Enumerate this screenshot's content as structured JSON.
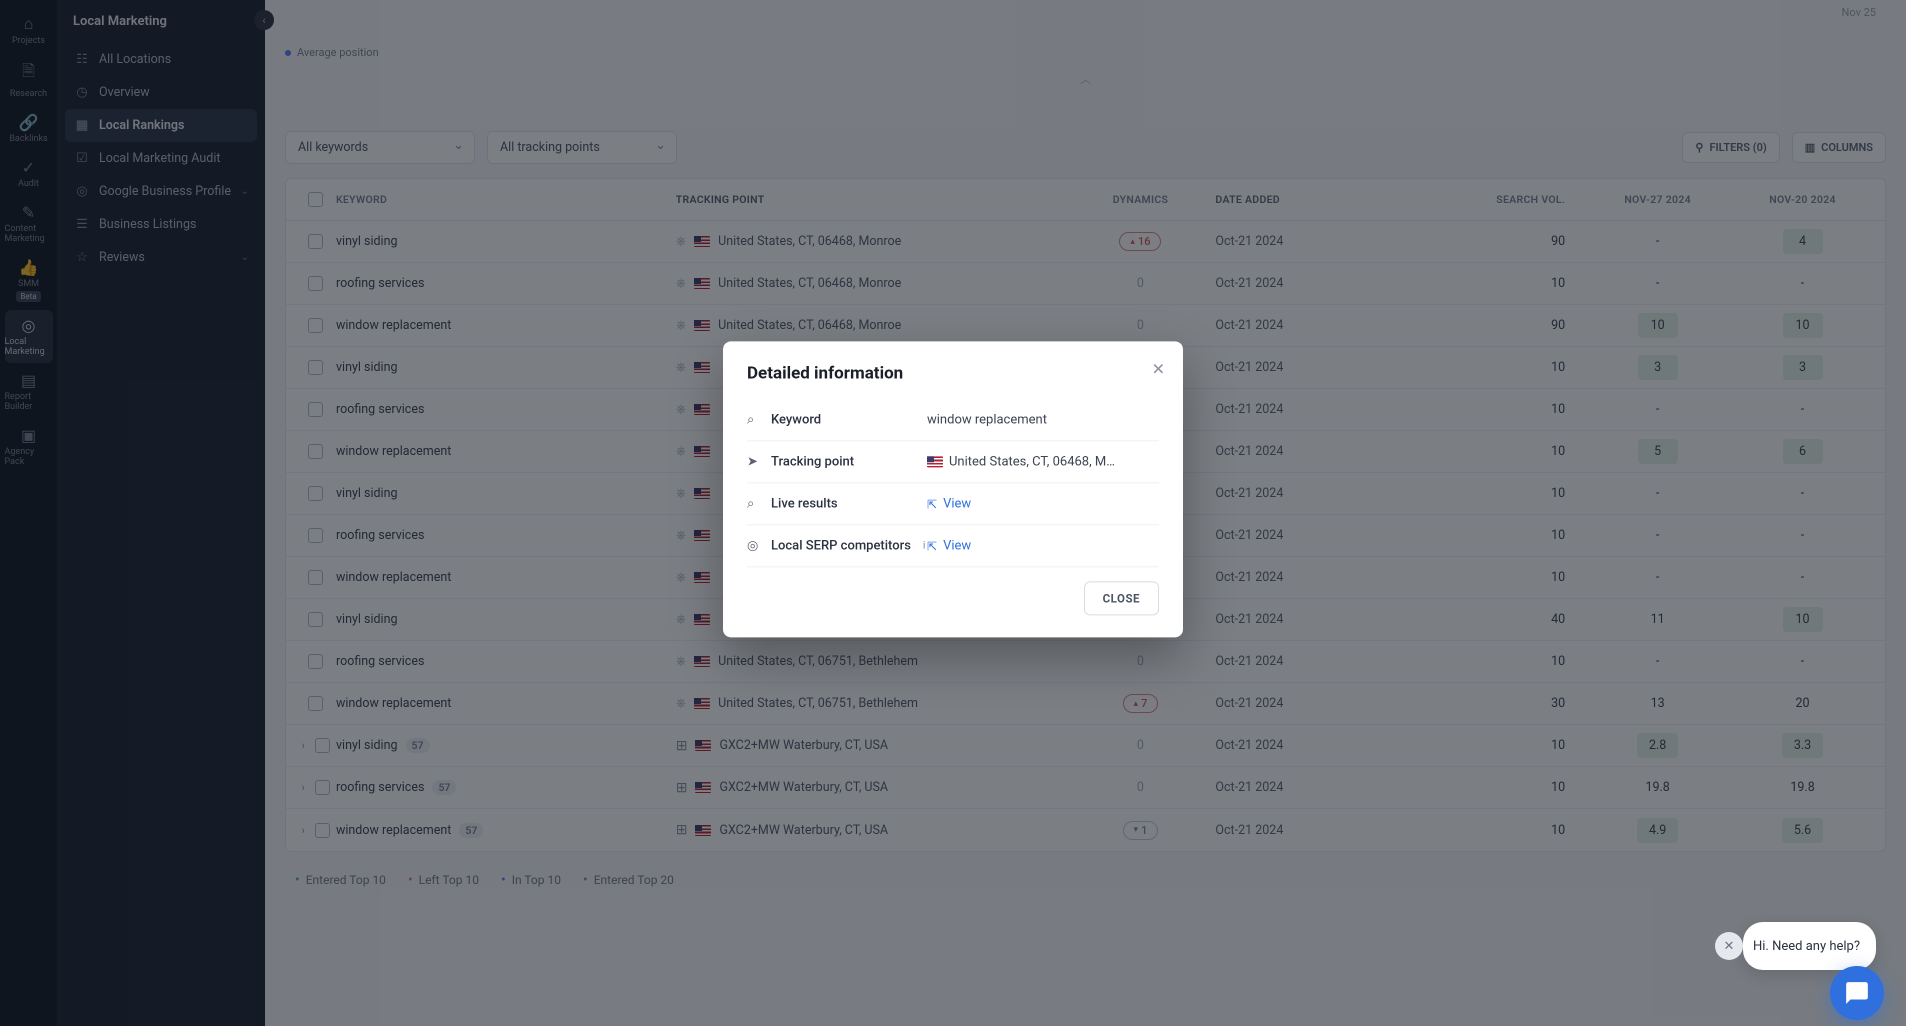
{
  "primaryNav": {
    "items": [
      {
        "label": "Projects",
        "icon": "home"
      },
      {
        "label": "Research",
        "icon": "doc"
      },
      {
        "label": "Backlinks",
        "icon": "link"
      },
      {
        "label": "Audit",
        "icon": "check"
      },
      {
        "label": "Content Marketing",
        "icon": "edit"
      },
      {
        "label": "SMM",
        "icon": "thumb",
        "badge": "Beta"
      },
      {
        "label": "Local Marketing",
        "icon": "pin",
        "active": true
      },
      {
        "label": "Report Builder",
        "icon": "report"
      },
      {
        "label": "Agency Pack",
        "icon": "agency"
      }
    ]
  },
  "secondaryNav": {
    "title": "Local Marketing",
    "items": [
      {
        "label": "All Locations",
        "icon": "grid",
        "hasSub": false
      },
      {
        "label": "Overview",
        "icon": "gauge",
        "hasSub": false
      },
      {
        "label": "Local Rankings",
        "icon": "bars",
        "active": true
      },
      {
        "label": "Local Marketing Audit",
        "icon": "audit"
      },
      {
        "label": "Google Business Profile",
        "icon": "gbp",
        "hasSub": true
      },
      {
        "label": "Business Listings",
        "icon": "list"
      },
      {
        "label": "Reviews",
        "icon": "star",
        "hasSub": true
      }
    ]
  },
  "chart": {
    "legend": "Average position",
    "dateLbl": "Nov 25"
  },
  "toolbar": {
    "filter1": "All keywords",
    "filter2": "All tracking points",
    "filtersBtn": "FILTERS (0)",
    "columnsBtn": "COLUMNS"
  },
  "table": {
    "headers": {
      "kw": "KEYWORD",
      "tp": "TRACKING POINT",
      "dyn": "DYNAMICS",
      "date": "DATE ADDED",
      "vol": "SEARCH VOL.",
      "d1": "NOV-27 2024",
      "d2": "NOV-20 2024"
    },
    "rows": [
      {
        "kw": "vinyl siding",
        "tpType": "pin",
        "tp": "United States, CT, 06468, Monroe",
        "dyn": {
          "type": "up",
          "val": "16"
        },
        "date": "Oct-21 2024",
        "vol": "90",
        "d1": "-",
        "d2": "4",
        "d2hl": true
      },
      {
        "kw": "roofing services",
        "tpType": "pin",
        "tp": "United States, CT, 06468, Monroe",
        "dyn": {
          "type": "zero"
        },
        "date": "Oct-21 2024",
        "vol": "10",
        "d1": "-",
        "d2": "-"
      },
      {
        "kw": "window replacement",
        "tpType": "pin",
        "tp": "United States, CT, 06468, Monroe",
        "dyn": {
          "type": "zero"
        },
        "date": "Oct-21 2024",
        "vol": "90",
        "d1": "10",
        "d1hl": true,
        "d2": "10",
        "d2hl": true
      },
      {
        "kw": "vinyl siding",
        "tpType": "pin",
        "tp": "",
        "dyn": {
          "type": "none"
        },
        "date": "Oct-21 2024",
        "vol": "10",
        "d1": "3",
        "d1hl": true,
        "d2": "3",
        "d2hl": true
      },
      {
        "kw": "roofing services",
        "tpType": "pin",
        "tp": "",
        "dyn": {
          "type": "none"
        },
        "date": "Oct-21 2024",
        "vol": "10",
        "d1": "-",
        "d2": "-"
      },
      {
        "kw": "window replacement",
        "tpType": "pin",
        "tp": "",
        "dyn": {
          "type": "none"
        },
        "date": "Oct-21 2024",
        "vol": "10",
        "d1": "5",
        "d1hl": true,
        "d2": "6",
        "d2hl": true
      },
      {
        "kw": "vinyl siding",
        "tpType": "pin",
        "tp": "",
        "dyn": {
          "type": "none"
        },
        "date": "Oct-21 2024",
        "vol": "10",
        "d1": "-",
        "d2": "-"
      },
      {
        "kw": "roofing services",
        "tpType": "pin",
        "tp": "",
        "dyn": {
          "type": "none"
        },
        "date": "Oct-21 2024",
        "vol": "10",
        "d1": "-",
        "d2": "-"
      },
      {
        "kw": "window replacement",
        "tpType": "pin",
        "tp": "",
        "dyn": {
          "type": "none"
        },
        "date": "Oct-21 2024",
        "vol": "10",
        "d1": "-",
        "d2": "-"
      },
      {
        "kw": "vinyl siding",
        "tpType": "pin",
        "tp": "",
        "dyn": {
          "type": "none"
        },
        "date": "Oct-21 2024",
        "vol": "40",
        "d1": "11",
        "d2": "10",
        "d2hl": true
      },
      {
        "kw": "roofing services",
        "tpType": "pin",
        "tp": "United States, CT, 06751, Bethlehem",
        "dyn": {
          "type": "zero"
        },
        "date": "Oct-21 2024",
        "vol": "10",
        "d1": "-",
        "d2": "-"
      },
      {
        "kw": "window replacement",
        "tpType": "pin",
        "tp": "United States, CT, 06751, Bethlehem",
        "dyn": {
          "type": "up",
          "val": "7"
        },
        "date": "Oct-21 2024",
        "vol": "30",
        "d1": "13",
        "d2": "20"
      },
      {
        "expand": true,
        "kw": "vinyl siding",
        "badge": "57",
        "tpType": "grid",
        "tp": "GXC2+MW Waterbury, CT, USA",
        "dyn": {
          "type": "zero"
        },
        "date": "Oct-21 2024",
        "vol": "10",
        "d1": "2.8",
        "d1hl": true,
        "d2": "3.3",
        "d2hl": true
      },
      {
        "expand": true,
        "kw": "roofing services",
        "badge": "57",
        "tpType": "grid",
        "tp": "GXC2+MW Waterbury, CT, USA",
        "dyn": {
          "type": "zero"
        },
        "date": "Oct-21 2024",
        "vol": "10",
        "d1": "19.8",
        "d2": "19.8"
      },
      {
        "expand": true,
        "kw": "window replacement",
        "badge": "57",
        "tpType": "grid",
        "tp": "GXC2+MW Waterbury, CT, USA",
        "dyn": {
          "type": "down",
          "val": "1"
        },
        "date": "Oct-21 2024",
        "vol": "10",
        "d1": "4.9",
        "d1hl": true,
        "d2": "5.6",
        "d2hl": true
      }
    ]
  },
  "legendFooter": {
    "l1": "Entered Top 10",
    "l2": "Left Top 10",
    "l3": "In Top 10",
    "l4": "Entered Top 20"
  },
  "modal": {
    "title": "Detailed information",
    "rows": {
      "keyword": {
        "label": "Keyword",
        "value": "window replacement"
      },
      "tracking": {
        "label": "Tracking point",
        "value": "United States, CT, 06468, M…"
      },
      "live": {
        "label": "Live results",
        "link": "View"
      },
      "serp": {
        "label": "Local SERP competitors",
        "sup": "i",
        "link": "View"
      }
    },
    "closeBtn": "CLOSE"
  },
  "help": {
    "text": "Hi. Need any help?"
  }
}
